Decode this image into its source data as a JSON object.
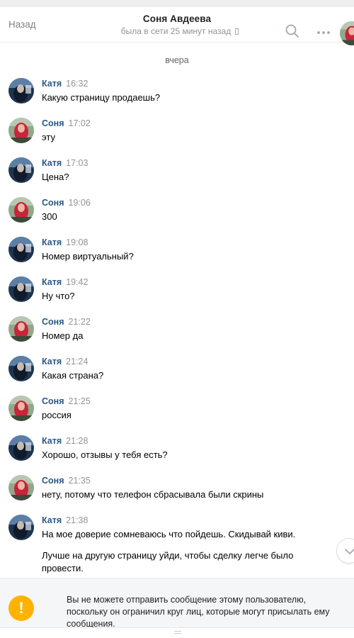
{
  "header": {
    "back_label": "Назад",
    "title": "Соня Авдеева",
    "status": "была в сети 25 минут назад"
  },
  "date_separator": "вчера",
  "messages": [
    {
      "author": "Катя",
      "time": "16:32",
      "lines": [
        "Какую страницу продаешь?"
      ]
    },
    {
      "author": "Соня",
      "time": "17:02",
      "lines": [
        "эту"
      ]
    },
    {
      "author": "Катя",
      "time": "17:03",
      "lines": [
        "Цена?"
      ]
    },
    {
      "author": "Соня",
      "time": "19:06",
      "lines": [
        "300"
      ]
    },
    {
      "author": "Катя",
      "time": "19:08",
      "lines": [
        "Номер виртуальный?"
      ]
    },
    {
      "author": "Катя",
      "time": "19:42",
      "lines": [
        "Ну что?"
      ]
    },
    {
      "author": "Соня",
      "time": "21:22",
      "lines": [
        "Номер да"
      ]
    },
    {
      "author": "Катя",
      "time": "21:24",
      "lines": [
        "Какая страна?"
      ]
    },
    {
      "author": "Соня",
      "time": "21:25",
      "lines": [
        "россия"
      ]
    },
    {
      "author": "Катя",
      "time": "21:28",
      "lines": [
        "Хорошо, отзывы у тебя есть?"
      ]
    },
    {
      "author": "Соня",
      "time": "21:35",
      "lines": [
        "нету, потому что телефон сбрасывала были скрины"
      ]
    },
    {
      "author": "Катя",
      "time": "21:38",
      "lines": [
        "На мое доверие сомневаюсь что пойдешь. Скидывай киви.",
        "Лучше на другую страницу уйди, чтобы сделку легче было провести."
      ]
    }
  ],
  "notice": {
    "icon_glyph": "!",
    "text": "Вы не можете отправить сообщение этому пользователю, поскольку он ограничил круг лиц, которые могут присылать ему сообщения."
  },
  "colors": {
    "author_name": "#2a5885",
    "warning": "#ffb300",
    "muted": "#939393"
  }
}
